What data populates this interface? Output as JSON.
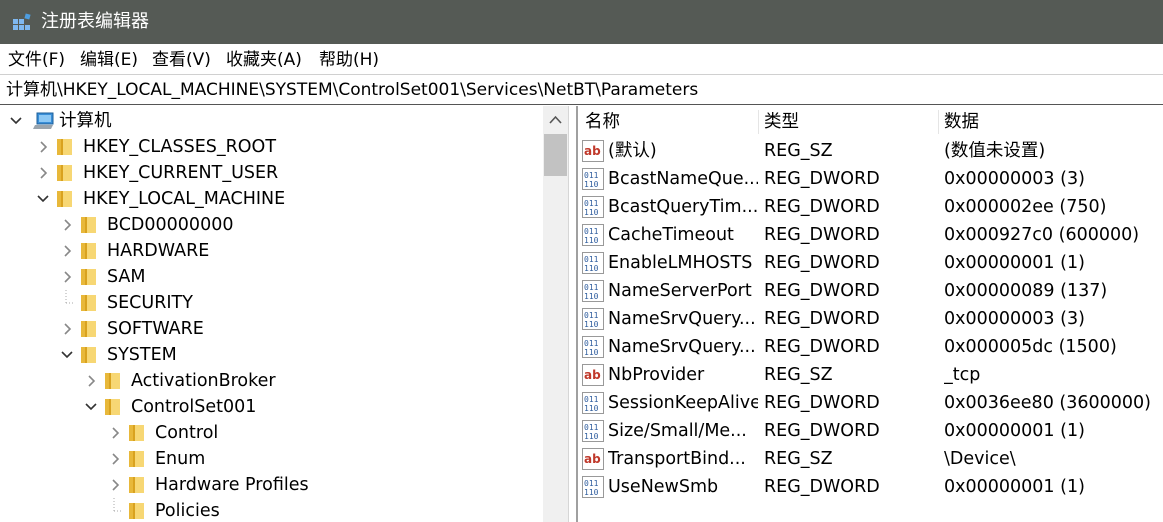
{
  "window": {
    "title": "注册表编辑器",
    "app_icon": "registry-editor-icon",
    "title_bar_color": "#555a55"
  },
  "menu": {
    "file": "文件(F)",
    "edit": "编辑(E)",
    "view": "查看(V)",
    "favorites": "收藏夹(A)",
    "help": "帮助(H)"
  },
  "address": {
    "path": "计算机\\HKEY_LOCAL_MACHINE\\SYSTEM\\ControlSet001\\Services\\NetBT\\Parameters"
  },
  "tree": {
    "root": {
      "label": "计算机",
      "state": "expanded",
      "icon": "computer-icon"
    },
    "nodes": [
      {
        "label": "HKEY_CLASSES_ROOT",
        "state": "collapsed"
      },
      {
        "label": "HKEY_CURRENT_USER",
        "state": "collapsed"
      },
      {
        "label": "HKEY_LOCAL_MACHINE",
        "state": "expanded"
      },
      {
        "label": "BCD00000000",
        "state": "collapsed"
      },
      {
        "label": "HARDWARE",
        "state": "collapsed"
      },
      {
        "label": "SAM",
        "state": "collapsed"
      },
      {
        "label": "SECURITY",
        "state": "leaf"
      },
      {
        "label": "SOFTWARE",
        "state": "collapsed"
      },
      {
        "label": "SYSTEM",
        "state": "expanded"
      },
      {
        "label": "ActivationBroker",
        "state": "collapsed"
      },
      {
        "label": "ControlSet001",
        "state": "expanded"
      },
      {
        "label": "Control",
        "state": "collapsed"
      },
      {
        "label": "Enum",
        "state": "collapsed"
      },
      {
        "label": "Hardware Profiles",
        "state": "collapsed"
      },
      {
        "label": "Policies",
        "state": "leaf"
      }
    ]
  },
  "list": {
    "headers": {
      "name": "名称",
      "type": "类型",
      "data": "数据"
    },
    "rows": [
      {
        "icon": "string-value-icon",
        "name": "(默认)",
        "type": "REG_SZ",
        "data": "(数值未设置)"
      },
      {
        "icon": "binary-value-icon",
        "name": "BcastNameQue...",
        "type": "REG_DWORD",
        "data": "0x00000003 (3)"
      },
      {
        "icon": "binary-value-icon",
        "name": "BcastQueryTim...",
        "type": "REG_DWORD",
        "data": "0x000002ee (750)"
      },
      {
        "icon": "binary-value-icon",
        "name": "CacheTimeout",
        "type": "REG_DWORD",
        "data": "0x000927c0 (600000)"
      },
      {
        "icon": "binary-value-icon",
        "name": "EnableLMHOSTS",
        "type": "REG_DWORD",
        "data": "0x00000001 (1)"
      },
      {
        "icon": "binary-value-icon",
        "name": "NameServerPort",
        "type": "REG_DWORD",
        "data": "0x00000089 (137)"
      },
      {
        "icon": "binary-value-icon",
        "name": "NameSrvQuery...",
        "type": "REG_DWORD",
        "data": "0x00000003 (3)"
      },
      {
        "icon": "binary-value-icon",
        "name": "NameSrvQuery...",
        "type": "REG_DWORD",
        "data": "0x000005dc (1500)"
      },
      {
        "icon": "string-value-icon",
        "name": "NbProvider",
        "type": "REG_SZ",
        "data": "_tcp"
      },
      {
        "icon": "binary-value-icon",
        "name": "SessionKeepAlive",
        "type": "REG_DWORD",
        "data": "0x0036ee80 (3600000)"
      },
      {
        "icon": "binary-value-icon",
        "name": "Size/Small/Me...",
        "type": "REG_DWORD",
        "data": "0x00000001 (1)"
      },
      {
        "icon": "string-value-icon",
        "name": "TransportBind...",
        "type": "REG_SZ",
        "data": "\\Device\\"
      },
      {
        "icon": "binary-value-icon",
        "name": "UseNewSmb",
        "type": "REG_DWORD",
        "data": "0x00000001 (1)"
      }
    ]
  },
  "colors": {
    "folder": "#e8b83a",
    "string_icon": "#c0392b",
    "binary_icon": "#2f5d9e"
  }
}
